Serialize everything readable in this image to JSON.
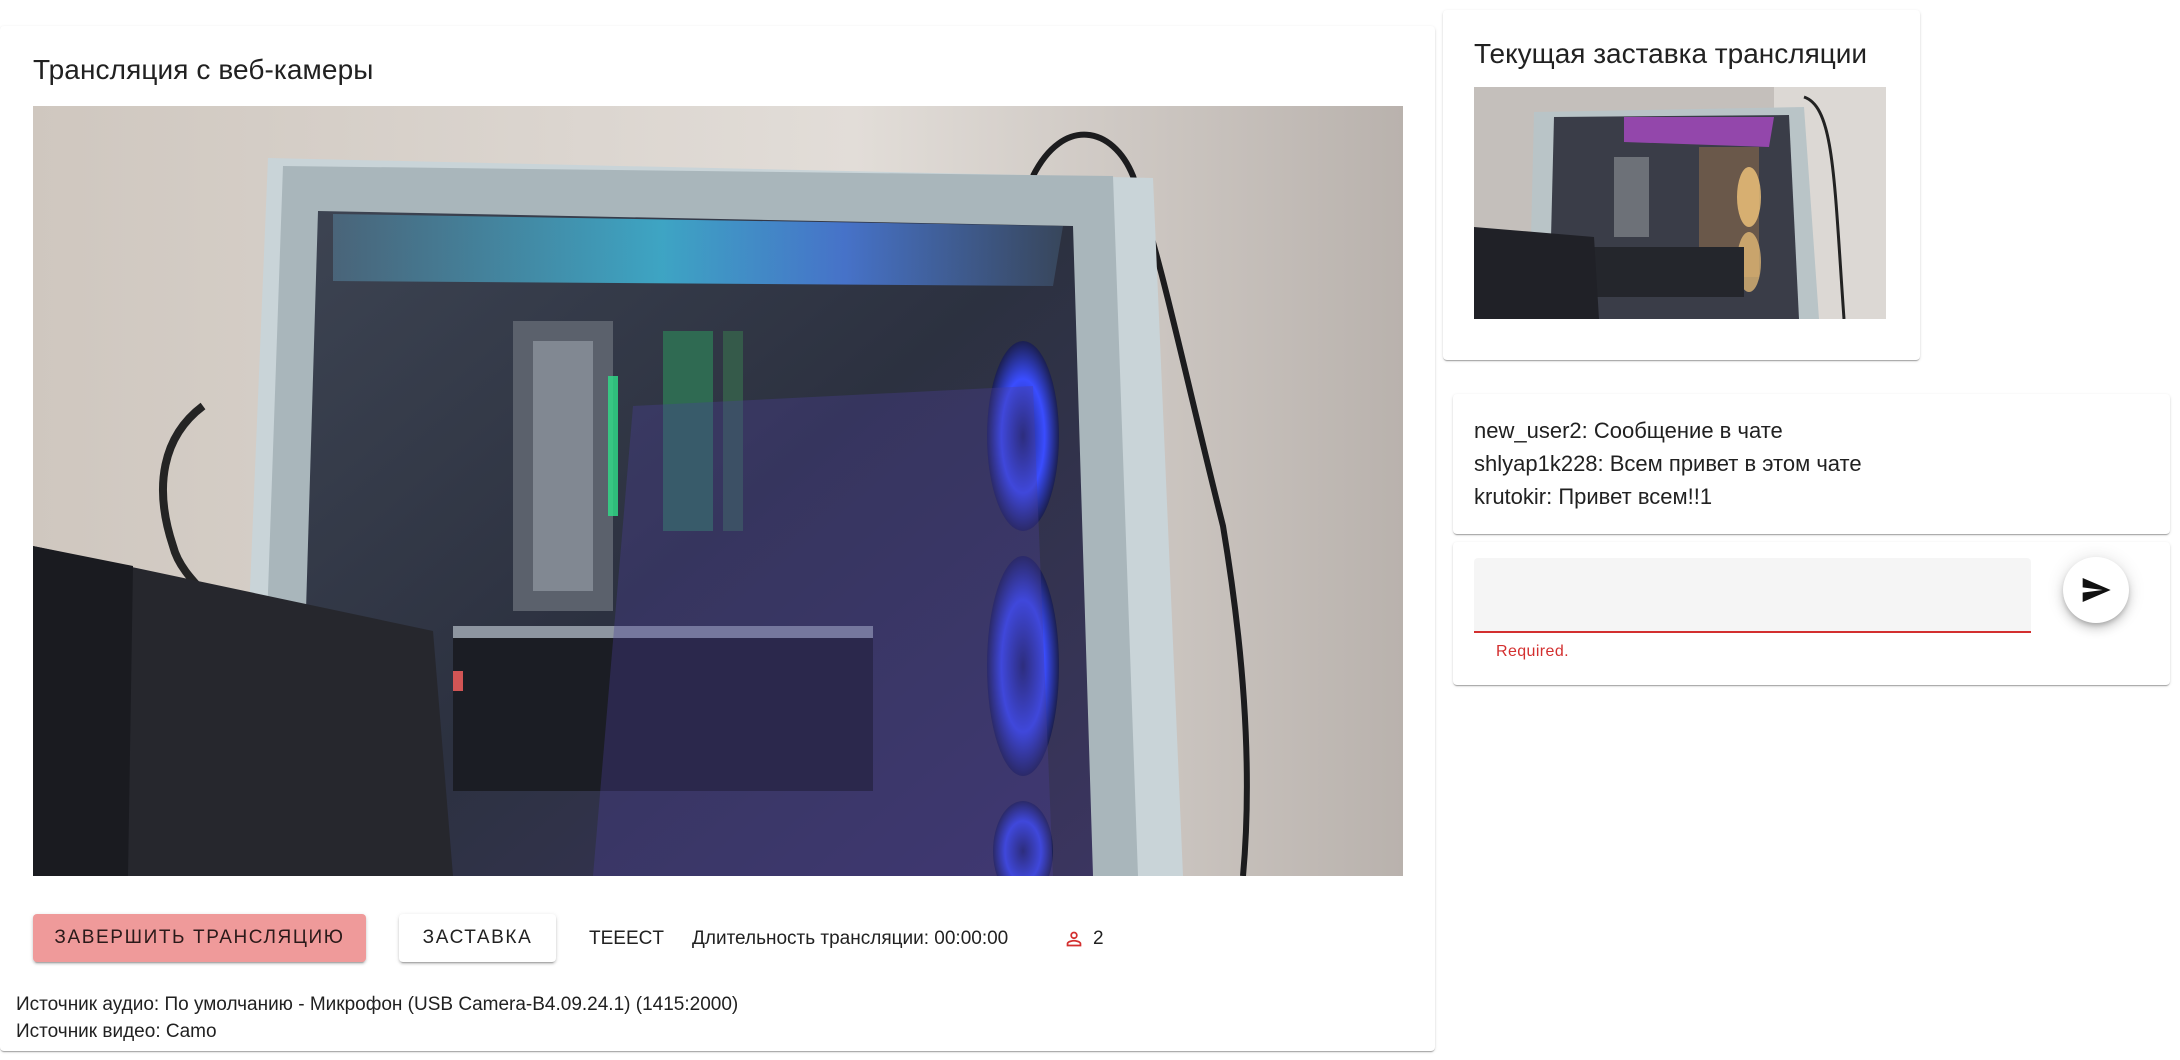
{
  "stream": {
    "title": "Трансляция с веб-камеры",
    "end_button_label": "Завершить трансляцию",
    "splash_button_label": "Заставка",
    "stream_name": "TEEECT",
    "duration_text": "Длительность трансляции: 00:00:00",
    "viewers_count": "2",
    "viewers_icon": "person-outline-icon",
    "audio_source": "Источник аудио: По умолчанию - Микрофон (USB Camera-B4.09.24.1) (1415:2000)",
    "video_source": "Источник видео: Camo"
  },
  "splash": {
    "title": "Текущая заставка трансляции"
  },
  "chat": {
    "messages": [
      {
        "text": "new_user2: Сообщение в чате"
      },
      {
        "text": "shlyap1k228: Всем привет в этом чате"
      },
      {
        "text": "krutokir: Привет всем!!1"
      }
    ],
    "input_value": "",
    "hint": "Required.",
    "send_icon": "send-icon"
  },
  "colors": {
    "end_button_bg": "#ef9a9a",
    "error": "#d32f2f",
    "viewers_icon": "#d32f2f"
  }
}
